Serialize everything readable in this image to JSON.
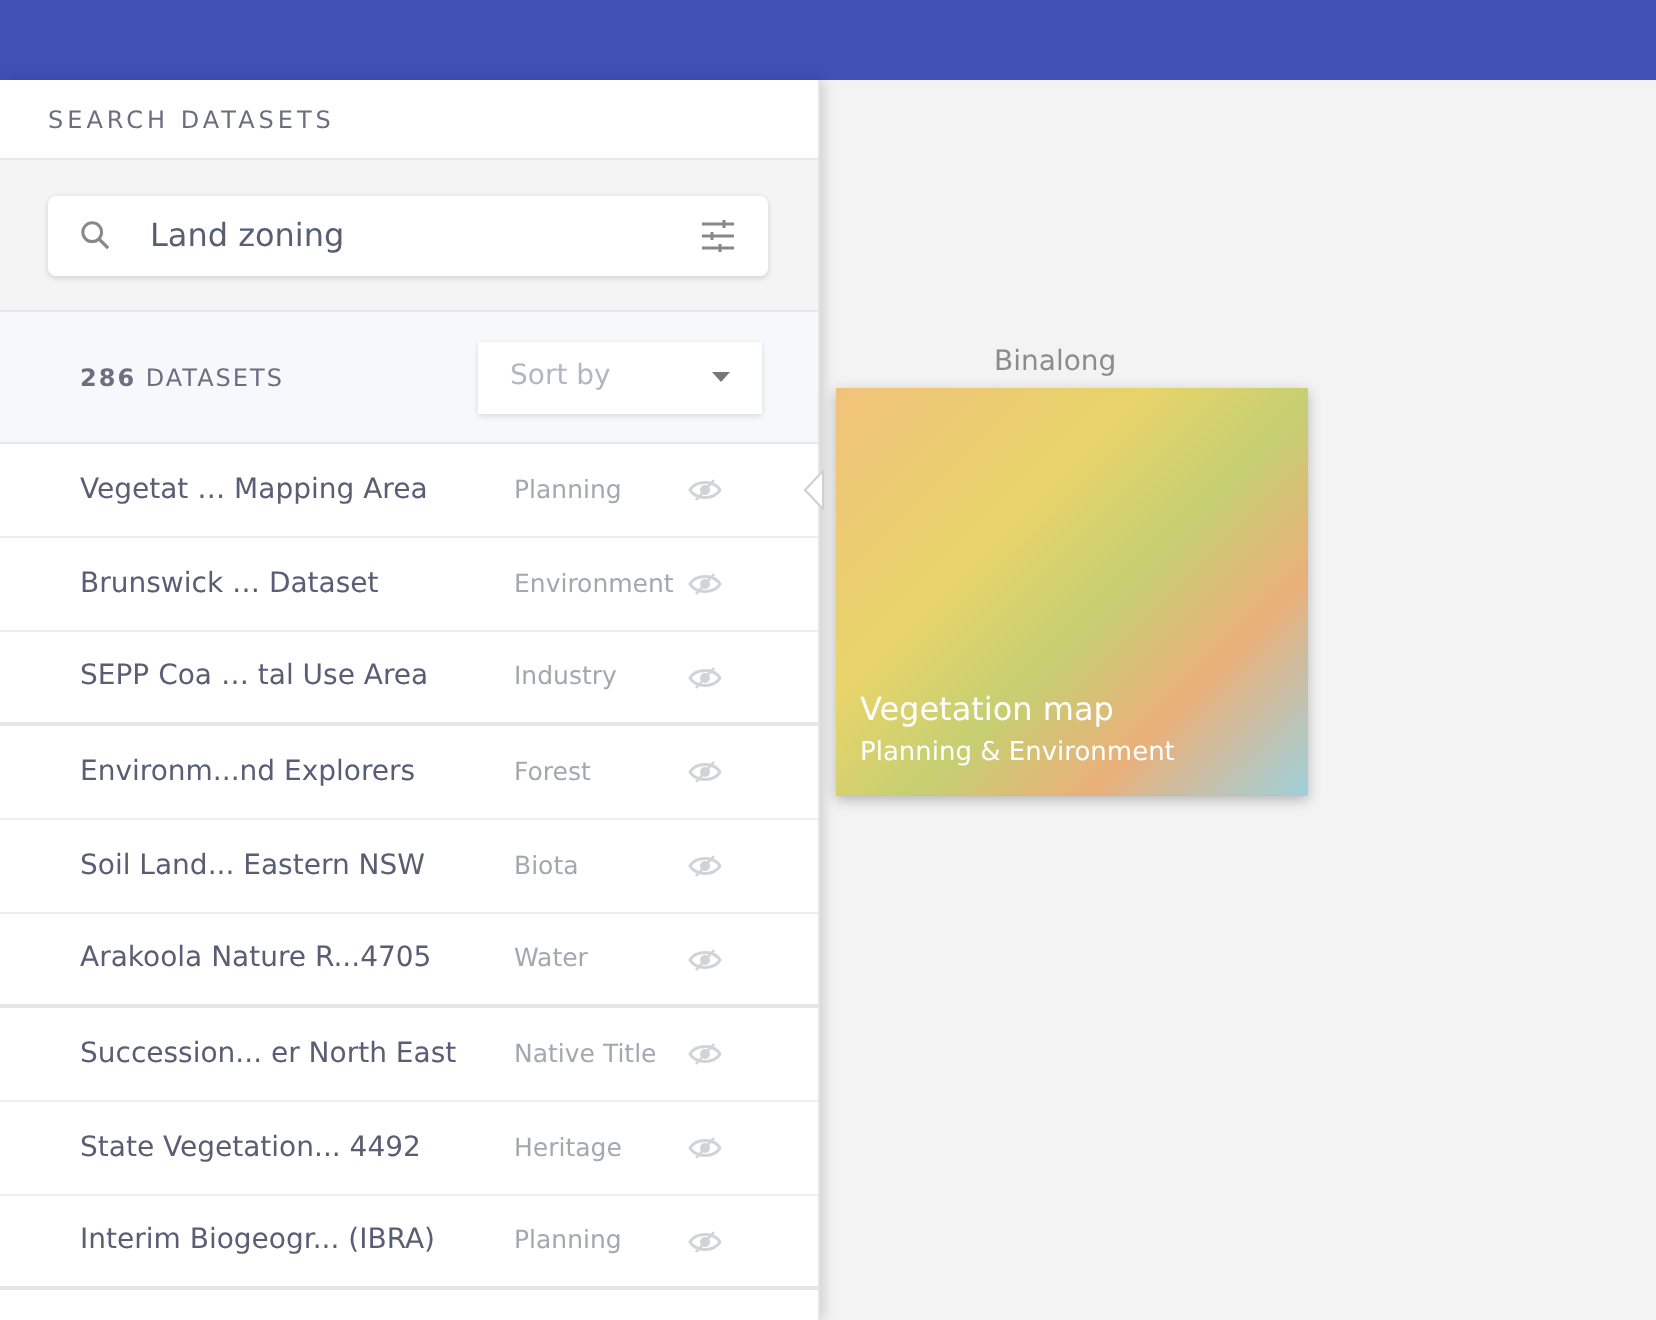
{
  "panel": {
    "title": "SEARCH DATASETS",
    "search": {
      "value": "Land zoning"
    },
    "count": {
      "number": "286",
      "label": "DATASETS"
    },
    "sort": {
      "placeholder": "Sort by"
    }
  },
  "datasets": [
    {
      "name": "Vegetat … Mapping Area",
      "category": "Planning"
    },
    {
      "name": "Brunswick … Dataset",
      "category": "Environment"
    },
    {
      "name": "SEPP Coa … tal Use Area",
      "category": "Industry"
    },
    {
      "name": "Environm...nd Explorers",
      "category": "Forest"
    },
    {
      "name": "Soil Land... Eastern NSW",
      "category": "Biota"
    },
    {
      "name": "Arakoola Nature R...4705",
      "category": "Water"
    },
    {
      "name": "Succession... er North East",
      "category": "Native Title"
    },
    {
      "name": "State Vegetation... 4492",
      "category": "Heritage"
    },
    {
      "name": "Interim Biogeogr... (IBRA)",
      "category": "Planning"
    }
  ],
  "map": {
    "place_label": "Binalong",
    "preview": {
      "title": "Vegetation map",
      "subtitle": "Planning & Environment"
    }
  }
}
